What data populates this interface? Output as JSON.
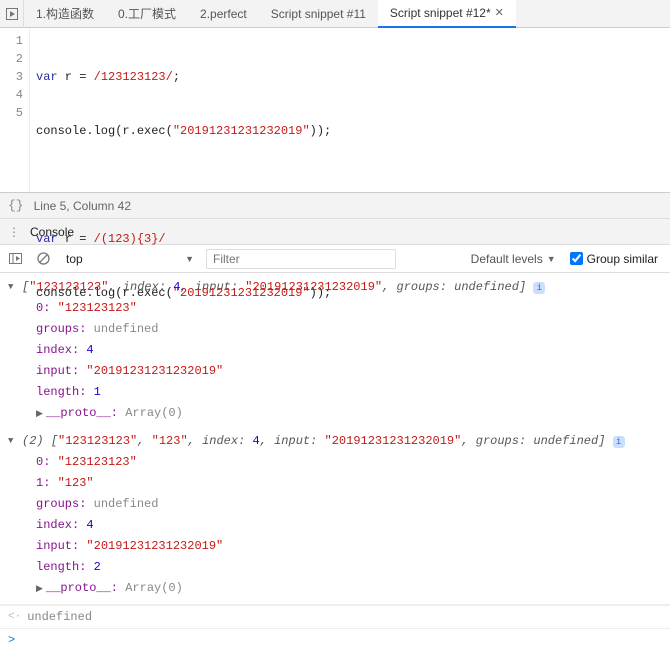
{
  "tabs": {
    "t0": "1.构造函数",
    "t1": "0.工厂模式",
    "t2": "2.perfect",
    "t3": "Script snippet #11",
    "t4": "Script snippet #12*"
  },
  "editor": {
    "lines": [
      "1",
      "2",
      "3",
      "4",
      "5"
    ],
    "kw_var": "var",
    "l1a": " r = ",
    "l1_reg": "/123123123/",
    "l1b": ";",
    "l2a": "console.log(r.exec(",
    "l2_str": "\"20191231231232019\"",
    "l2b": "));",
    "l4a": " r = ",
    "l4_reg": "/(123){3}/",
    "l5a": "console.log(r.exec(",
    "l5_str": "\"20191231231232019\"",
    "l5b": "));"
  },
  "status": {
    "cursor": "Line 5, Column 42"
  },
  "consoleHeader": {
    "label": "Console"
  },
  "toolbar": {
    "context": "top",
    "filter_placeholder": "Filter",
    "levels": "Default levels",
    "group": "Group similar"
  },
  "out1": {
    "summary_open": "[",
    "s0": "\"123123123\"",
    "k_index": "index:",
    "v_index": "4",
    "k_input": "input:",
    "v_input": "\"20191231231232019\"",
    "k_groups": "groups:",
    "v_groups": "undefined",
    "summary_close": "]",
    "p0k": "0:",
    "p0v": "\"123123123\"",
    "pg_k": "groups:",
    "pg_v": "undefined",
    "pi_k": "index:",
    "pi_v": "4",
    "pin_k": "input:",
    "pin_v": "\"20191231231232019\"",
    "pl_k": "length:",
    "pl_v": "1",
    "proto_k": "__proto__:",
    "proto_v": "Array(0)"
  },
  "out2": {
    "count": "(2)",
    "summary_open": "[",
    "s0": "\"123123123\"",
    "s1": "\"123\"",
    "k_index": "index:",
    "v_index": "4",
    "k_input": "input:",
    "v_input": "\"20191231231232019\"",
    "k_groups": "groups:",
    "v_groups": "undefined",
    "summary_close": "]",
    "p0k": "0:",
    "p0v": "\"123123123\"",
    "p1k": "1:",
    "p1v": "\"123\"",
    "pg_k": "groups:",
    "pg_v": "undefined",
    "pi_k": "index:",
    "pi_v": "4",
    "pin_k": "input:",
    "pin_v": "\"20191231231232019\"",
    "pl_k": "length:",
    "pl_v": "2",
    "proto_k": "__proto__:",
    "proto_v": "Array(0)"
  },
  "return_value": "undefined",
  "prompt": ">"
}
